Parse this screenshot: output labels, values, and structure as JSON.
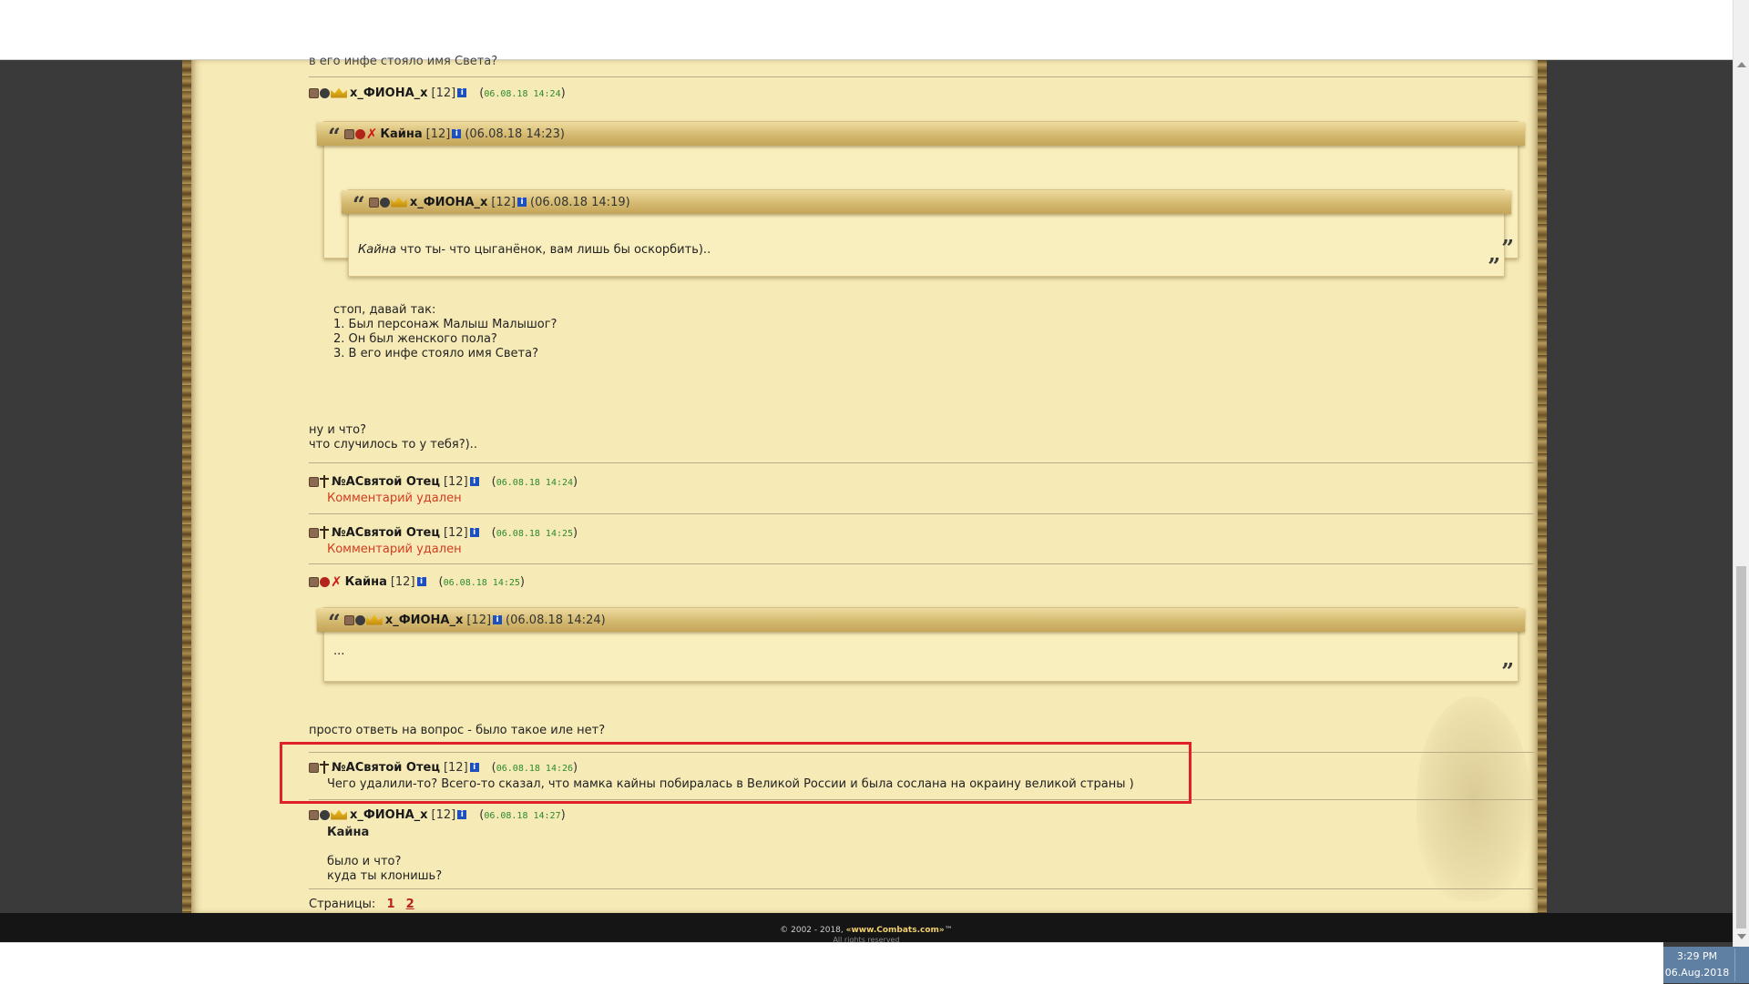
{
  "cut_text": "в его инфе стояло имя Света?",
  "posts": [
    {
      "nick": "x_ФИОНА_x",
      "level": "[12]",
      "date": "06.08.18 14:24",
      "quote": {
        "nick": "Кайна",
        "level": "[12]",
        "date": "(06.08.18 14:23)",
        "nested_quote": {
          "nick": "x_ФИОНА_x",
          "level": "[12]",
          "date": "(06.08.18 14:19)",
          "text_name": "Кайна",
          "text": " что ты- что цыганёнок, вам лишь бы оскорбить).."
        },
        "text": "стоп, давай так:\n1. Был персонаж Малыш Малышог?\n2. Он был женского пола?\n3. В его инфе стояло имя Света?"
      },
      "text": "ну и что?\nчто случилось то у тебя?).."
    },
    {
      "nick": "№AСвятой Отец",
      "level": "[12]",
      "date": "06.08.18 14:24",
      "deleted": "Комментарий удален"
    },
    {
      "nick": "№AСвятой Отец",
      "level": "[12]",
      "date": "06.08.18 14:25",
      "deleted": "Комментарий удален"
    },
    {
      "nick": "Кайна",
      "level": "[12]",
      "date": "06.08.18 14:25",
      "quote": {
        "nick": "x_ФИОНА_x",
        "level": "[12]",
        "date": "(06.08.18 14:24)",
        "text": "..."
      },
      "text": "просто ответь на вопрос - было такое иле нет?"
    },
    {
      "nick": "№AСвятой Отец",
      "level": "[12]",
      "date": "06.08.18 14:26",
      "text": "Чего удалили-то? Всего-то сказал, что мамка кайны побиралась в Великой России и была сослана на окраину великой страны )"
    },
    {
      "nick": "x_ФИОНА_x",
      "level": "[12]",
      "date": "06.08.18 14:27",
      "addressee": "Кайна",
      "text": "было и что?\nкуда ты клонишь?"
    }
  ],
  "pagination": {
    "label": "Страницы:",
    "pages": [
      "1",
      "2"
    ],
    "current": "2"
  },
  "footer": {
    "copyright_prefix": "© 2002 - 2018, ",
    "copyright_site": "«www.Combats.com»",
    "copyright_suffix": "™",
    "rights": "All rights reserved"
  },
  "taskbar": {
    "time": "3:29 PM",
    "date": "06.Aug.2018"
  },
  "icons": {
    "align": "alignment-icon",
    "clan": "clan-emblem-icon",
    "crown": "crown-icon",
    "cross": "cross-icon",
    "x": "red-x-icon",
    "info": "info-icon"
  },
  "colors": {
    "parchment": "#f6eab6",
    "date_green": "#2a8a2a",
    "deleted_red": "#d43c1f",
    "highlight_red": "#e0212a",
    "page_link_red": "#b8231a"
  }
}
